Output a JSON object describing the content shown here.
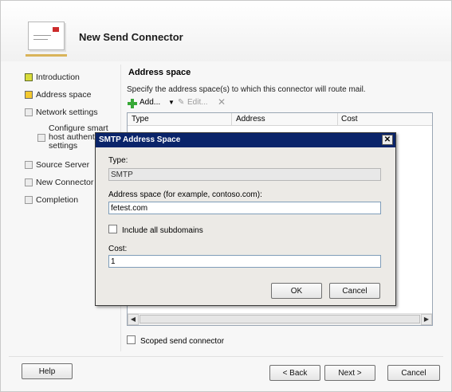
{
  "wizard": {
    "title": "New Send Connector"
  },
  "nav": {
    "items": [
      {
        "label": "Introduction",
        "state": "complete"
      },
      {
        "label": "Address space",
        "state": "current"
      },
      {
        "label": "Network settings",
        "state": "pending"
      },
      {
        "label": "Configure smart host authentication settings",
        "state": "pending",
        "lines": [
          "Configure smart",
          "host authentic",
          "settings"
        ]
      },
      {
        "label": "Source Server",
        "state": "pending"
      },
      {
        "label": "New Connector",
        "state": "pending"
      },
      {
        "label": "Completion",
        "state": "pending"
      }
    ]
  },
  "address_space": {
    "title": "Address space",
    "description": "Specify the address space(s) to which this connector will route mail.",
    "toolbar": {
      "add": "Add...",
      "edit": "Edit...",
      "delete_icon": "x-icon"
    },
    "columns": [
      "Type",
      "Address",
      "Cost"
    ],
    "scoped_label": "Scoped send connector",
    "scoped_checked": false
  },
  "buttons": {
    "help": "Help",
    "back": "< Back",
    "next": "Next >",
    "cancel": "Cancel"
  },
  "dialog": {
    "title": "SMTP Address Space",
    "close_icon": "close-icon",
    "type_label": "Type:",
    "type_value": "SMTP",
    "address_label": "Address space (for example, contoso.com):",
    "address_value": "fetest.com",
    "subdomains_label": "Include all subdomains",
    "subdomains_checked": false,
    "cost_label": "Cost:",
    "cost_value": "1",
    "ok": "OK",
    "cancel": "Cancel"
  },
  "colors": {
    "title_bar": "#0a246a",
    "current_step": "#f4c92e",
    "add_icon": "#37a837"
  }
}
